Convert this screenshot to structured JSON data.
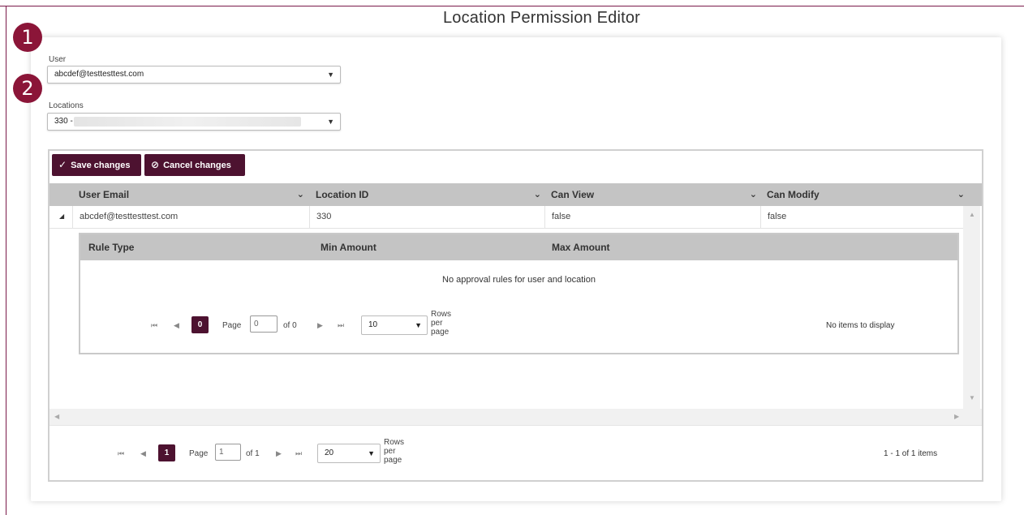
{
  "page": {
    "title": "Location Permission Editor"
  },
  "callouts": [
    "1",
    "2"
  ],
  "user_field": {
    "label": "User",
    "value": "abcdef@testtesttest.com"
  },
  "locations_field": {
    "label": "Locations",
    "value": "330 -"
  },
  "toolbar": {
    "save_label": "Save changes",
    "cancel_label": "Cancel changes"
  },
  "grid": {
    "columns": [
      "User Email",
      "Location ID",
      "Can View",
      "Can Modify"
    ],
    "rows": [
      {
        "user_email": "abcdef@testtesttest.com",
        "location_id": "330",
        "can_view": "false",
        "can_modify": "false"
      }
    ]
  },
  "detail": {
    "columns": [
      "Rule Type",
      "Min Amount",
      "Max Amount"
    ],
    "empty_message": "No approval rules for user and location",
    "pager": {
      "current_page": "0",
      "page_label": "Page",
      "page_input": "0",
      "of_label": "of 0",
      "page_size": "10",
      "rows_per_page": [
        "Rows",
        "per",
        "page"
      ],
      "info": "No items to display"
    }
  },
  "pager": {
    "current_page": "1",
    "page_label": "Page",
    "page_input": "1",
    "of_label": "of 1",
    "page_size": "20",
    "rows_per_page": [
      "Rows",
      "per",
      "page"
    ],
    "info": "1 - 1 of 1 items"
  },
  "colors": {
    "accent": "#4d1230",
    "callout": "#8b1538",
    "header_bg": "#c4c4c4"
  }
}
